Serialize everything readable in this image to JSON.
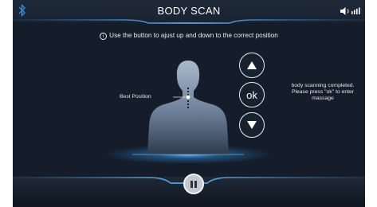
{
  "header": {
    "title": "BODY SCAN",
    "left_icon": "bluetooth-icon",
    "right_icon": "volume-signal-icon"
  },
  "instruction": {
    "icon": "info-icon",
    "text": "Use the button to ajust up and down to the correct position"
  },
  "body_scan": {
    "marker_label": "Best Position"
  },
  "controls": {
    "up_icon": "up-arrow-icon",
    "ok_label": "ok",
    "down_icon": "down-arrow-icon"
  },
  "status": {
    "lines": [
      "body scanning completed.",
      "Please press \"ok\" to enter",
      "massage"
    ]
  },
  "footer": {
    "pause_icon": "pause-icon"
  },
  "colors": {
    "background": "#151d2a",
    "accent_blue": "#2f8fe0",
    "text": "#e8edf3"
  }
}
